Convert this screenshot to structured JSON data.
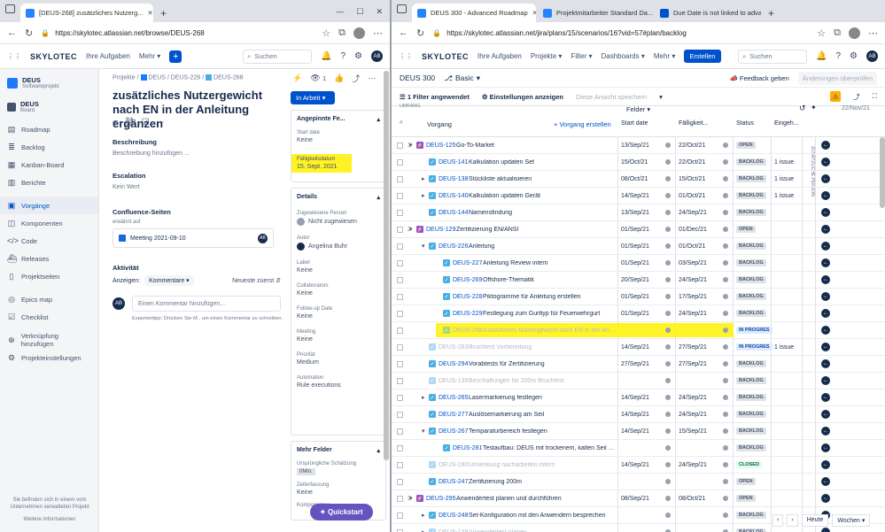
{
  "left": {
    "tabs": [
      {
        "label": "[DEUS-268] zusätzliches Nutzerg..."
      }
    ],
    "url": "https://skylotec.atlassian.net/browse/DEUS-268",
    "nav": {
      "logo": "SKYLOTEC",
      "my_tasks": "Ihre Aufgaben",
      "more": "Mehr",
      "search": "Suchen",
      "avatar": "AB"
    },
    "project": {
      "name": "DEUS",
      "type": "Softwareprojekt",
      "board_name": "DEUS",
      "board_type": "Board"
    },
    "sidebar": [
      {
        "label": "Roadmap",
        "icon": "roadmap-icon"
      },
      {
        "label": "Backlog",
        "icon": "backlog-icon"
      },
      {
        "label": "Kanban-Board",
        "icon": "board-icon"
      },
      {
        "label": "Berichte",
        "icon": "chart-icon"
      },
      {
        "label": "Vorgänge",
        "icon": "issues-icon"
      },
      {
        "label": "Komponenten",
        "icon": "components-icon"
      },
      {
        "label": "Code",
        "icon": "code-icon"
      },
      {
        "label": "Releases",
        "icon": "releases-icon"
      },
      {
        "label": "Projektseiten",
        "icon": "pages-icon"
      },
      {
        "label": "Epics map",
        "icon": "map-icon"
      },
      {
        "label": "Checklist",
        "icon": "checklist-icon"
      },
      {
        "label": "Verknüpfung hinzufügen",
        "icon": "link-icon"
      },
      {
        "label": "Projekteinstellungen",
        "icon": "settings-icon"
      }
    ],
    "sidebar_footer": "Sie befinden sich in einem vom Unternehmen verwalteten Projekt",
    "sidebar_more": "Weitere Informationen",
    "breadcrumb": [
      "Projekte",
      "DEUS",
      "DEUS-226",
      "DEUS-268"
    ],
    "watch_count": "1",
    "title": "zusätzliches Nutzergewicht nach EN in der Anleitung ergänzen",
    "status_button": "In Arbeit",
    "description_label": "Beschreibung",
    "description_placeholder": "Beschreibung hinzufügen ...",
    "escalation_label": "Escalation",
    "escalation_value": "Kein Wert",
    "confluence_label": "Confluence-Seiten",
    "confluence_sub": "erwähnt auf",
    "confluence_page": "Meeting 2021-09-10",
    "activity_label": "Aktivität",
    "show_label": "Anzeigen:",
    "show_value": "Kommentare",
    "sort": "Neueste zuerst",
    "comment_placeholder": "Einen Kommentar hinzufügen...",
    "tip": "Expertentipp: Drücken Sie M , um einen Kommentar zu schreiben.",
    "pinned_label": "Angepinnte Fe...",
    "fields": [
      {
        "k": "Start date",
        "v": "Keine"
      },
      {
        "k": "Fälligkeitsdatum",
        "v": "15. Sept. 2021"
      }
    ],
    "details_label": "Details",
    "details": [
      {
        "k": "Zugewiesene Person",
        "v": "Nicht zugewiesen"
      },
      {
        "k": "Autor",
        "v": "Angelina Buhr"
      },
      {
        "k": "Label",
        "v": "Keine"
      },
      {
        "k": "Collaborators",
        "v": "Keine"
      },
      {
        "k": "Follow-up Date",
        "v": "Keine"
      },
      {
        "k": "Meeting",
        "v": "Keine"
      },
      {
        "k": "Priorität",
        "v": "Medium"
      },
      {
        "k": "Automation",
        "v": "Rule executions"
      }
    ],
    "more_fields": "Mehr Felder",
    "extra": [
      {
        "k": "Ursprüngliche Schätzung",
        "v": "0Min."
      },
      {
        "k": "Zeiterfassung",
        "v": "Keine"
      },
      {
        "k": "Komponenten",
        "v": ""
      }
    ],
    "quickstart": "Quickstart"
  },
  "right": {
    "tabs": [
      {
        "label": "DEUS 300 - Advanced Roadmap"
      },
      {
        "label": "Projektmitarbeiter Standard Da..."
      },
      {
        "label": "Due Date is not linked to advan..."
      }
    ],
    "url": "https://skylotec.atlassian.net/jira/plans/15/scenarios/16?vid=57#plan/backlog",
    "nav": {
      "my_tasks": "Ihre Aufgaben",
      "projects": "Projekte",
      "filter": "Filter",
      "dashboards": "Dashboards",
      "more": "Mehr",
      "create": "Erstellen",
      "search": "Suchen"
    },
    "plan": "DEUS 300",
    "scenario": "Basic",
    "feedback": "Feedback geben",
    "changes": "Änderungen überprüfen",
    "filter_applied": "1 Filter angewendet",
    "apply_settings": "Einstellungen anzeigen",
    "save_view": "Diese Ansicht speichern",
    "scope": "UMFANG",
    "col_vorgang": "Vorgang",
    "create_issue": "+ Vorgang erstellen",
    "fields_label": "Felder",
    "columns": [
      "Start date",
      "Fälligkeit...",
      "Status",
      "Eingeh..."
    ],
    "timeline_date": "22/Nov/21",
    "vertical_label": "ZUSÄTZLICHE PERSON",
    "today": "Heute",
    "weeks": "Wochen",
    "rows": [
      {
        "n": "1",
        "key": "DEUS-125",
        "sum": "Go-To-Market",
        "start": "13/Sep/21",
        "due": "22/Oct/21",
        "status": "OPEN",
        "inc": ""
      },
      {
        "n": "",
        "key": "DEUS-141",
        "sum": "Kalkulation updaten Set",
        "start": "15/Oct/21",
        "due": "22/Oct/21",
        "status": "BACKLOG",
        "inc": "1 issue"
      },
      {
        "n": "",
        "key": "DEUS-138",
        "sum": "Stückliste aktualisieren",
        "start": "08/Oct/21",
        "due": "15/Oct/21",
        "status": "BACKLOG",
        "inc": "1 issue"
      },
      {
        "n": "",
        "key": "DEUS-140",
        "sum": "Kalkulation updaten Gerät",
        "start": "14/Sep/21",
        "due": "01/Oct/21",
        "status": "BACKLOG",
        "inc": "1 issue"
      },
      {
        "n": "",
        "key": "DEUS-144",
        "sum": "Namensfindung",
        "start": "13/Sep/21",
        "due": "24/Sep/21",
        "status": "BACKLOG",
        "inc": ""
      },
      {
        "n": "2",
        "key": "DEUS-129",
        "sum": "Zertifizierung EN/ANSI",
        "start": "01/Sep/21",
        "due": "01/Dec/21",
        "status": "OPEN",
        "inc": ""
      },
      {
        "n": "",
        "key": "DEUS-226",
        "sum": "Anleitung",
        "start": "01/Sep/21",
        "due": "01/Oct/21",
        "status": "BACKLOG",
        "inc": ""
      },
      {
        "n": "",
        "key": "DEUS-227",
        "sum": "Anleitung Review intern",
        "start": "01/Sep/21",
        "due": "03/Sep/21",
        "status": "BACKLOG",
        "inc": ""
      },
      {
        "n": "",
        "key": "DEUS-269",
        "sum": "Offshore-Thematik",
        "start": "20/Sep/21",
        "due": "24/Sep/21",
        "status": "BACKLOG",
        "inc": ""
      },
      {
        "n": "",
        "key": "DEUS-228",
        "sum": "Piktogramme für Anleitung erstellen",
        "start": "01/Sep/21",
        "due": "17/Sep/21",
        "status": "BACKLOG",
        "inc": ""
      },
      {
        "n": "",
        "key": "DEUS-229",
        "sum": "Festlegung zum Gurttyp für Feuerwehrgurt",
        "start": "01/Sep/21",
        "due": "24/Sep/21",
        "status": "BACKLOG",
        "inc": ""
      },
      {
        "n": "",
        "key": "DEUS-268",
        "sum": "zusätzliches Nutzergewicht nach EN in der Anleit...",
        "start": "",
        "due": "",
        "status": "IN PROGRES",
        "inc": ""
      },
      {
        "n": "",
        "key": "DEUS-283",
        "sum": "Bruchtest Vorbereitung",
        "start": "14/Sep/21",
        "due": "27/Sep/21",
        "status": "IN PROGRES",
        "inc": "1 issue"
      },
      {
        "n": "",
        "key": "DEUS-294",
        "sum": "Vorabtests für Zertifizierung",
        "start": "27/Sep/21",
        "due": "27/Sep/21",
        "status": "BACKLOG",
        "inc": ""
      },
      {
        "n": "",
        "key": "DEUS-135",
        "sum": "Beschaffungen für 200m Bruchtest",
        "start": "",
        "due": "",
        "status": "BACKLOG",
        "inc": ""
      },
      {
        "n": "",
        "key": "DEUS-265",
        "sum": "Lasermarkierung festlegen",
        "start": "14/Sep/21",
        "due": "24/Sep/21",
        "status": "BACKLOG",
        "inc": ""
      },
      {
        "n": "",
        "key": "DEUS-277",
        "sum": "Auslösemarkierung am Seil",
        "start": "14/Sep/21",
        "due": "24/Sep/21",
        "status": "BACKLOG",
        "inc": ""
      },
      {
        "n": "",
        "key": "DEUS-267",
        "sum": "Temparaturbereich festlegen",
        "start": "14/Sep/21",
        "due": "15/Sep/21",
        "status": "BACKLOG",
        "inc": ""
      },
      {
        "n": "",
        "key": "DEUS-281",
        "sum": "Testaufbau: DEUS mit trockenem, kalten Seil test...",
        "start": "",
        "due": "",
        "status": "BACKLOG",
        "inc": ""
      },
      {
        "n": "",
        "key": "DEUS-180",
        "sum": "Umlenkung nacharbeiten intern",
        "start": "14/Sep/21",
        "due": "24/Sep/21",
        "status": "CLOSED",
        "inc": ""
      },
      {
        "n": "",
        "key": "DEUS-247",
        "sum": "Zertifizierung 200m",
        "start": "",
        "due": "",
        "status": "OPEN",
        "inc": ""
      },
      {
        "n": "3",
        "key": "DEUS-295",
        "sum": "Anwendertest planen und durchführen",
        "start": "08/Sep/21",
        "due": "08/Oct/21",
        "status": "OPEN",
        "inc": ""
      },
      {
        "n": "",
        "key": "DEUS-248",
        "sum": "Set-Konfiguration mit den Anwendern besprechen",
        "start": "",
        "due": "",
        "status": "BACKLOG",
        "inc": ""
      },
      {
        "n": "",
        "key": "DEUS-139",
        "sum": "Anwendertest planen",
        "start": "",
        "due": "",
        "status": "BACKLOG",
        "inc": ""
      }
    ],
    "colors": {
      "epic": "#904ee2",
      "story": "#36b37e",
      "task": "#4bade8",
      "subtask": "#4bade8",
      "highlight": "#fff200"
    }
  }
}
